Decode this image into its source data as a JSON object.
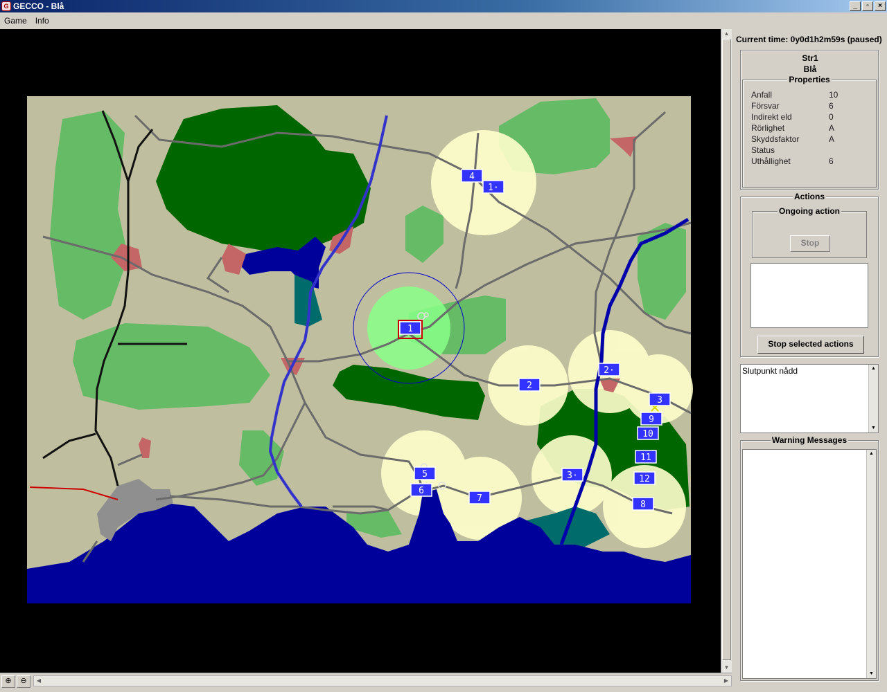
{
  "window": {
    "title": "GECCO - Blå",
    "app_icon": "gecco-logo-icon"
  },
  "menu": {
    "items": [
      "Game",
      "Info"
    ]
  },
  "status": {
    "current_time": "Current time: 0y0d1h2m59s (paused)"
  },
  "unit": {
    "name": "Str1",
    "side": "Blå"
  },
  "properties": {
    "title": "Properties",
    "rows": [
      {
        "key": "Anfall",
        "value": "10"
      },
      {
        "key": "Försvar",
        "value": "6"
      },
      {
        "key": "Indirekt eld",
        "value": "0"
      },
      {
        "key": "Rörlighet",
        "value": "A"
      },
      {
        "key": "Skyddsfaktor",
        "value": "A"
      },
      {
        "key": "Status",
        "value": ""
      },
      {
        "key": "Uthållighet",
        "value": "6"
      }
    ]
  },
  "actions": {
    "title": "Actions",
    "ongoing_title": "Ongoing action",
    "stop_label": "Stop",
    "stop_selected_label": "Stop selected actions"
  },
  "messages": {
    "text": "Slutpunkt nådd"
  },
  "warnings": {
    "title": "Warning Messages"
  },
  "map": {
    "colors": {
      "background": "#000000",
      "terrain": "#bfbf9f",
      "light_forest": "#66bb66",
      "dense_forest": "#006600",
      "water": "#00009b",
      "lake_teal": "#006b6b",
      "town": "#c46666",
      "road": "#6b6b6b",
      "river": "#3333cc",
      "unit_fill": "#3333ff",
      "selection": "#cc0000"
    },
    "units": [
      {
        "label": "4"
      },
      {
        "label": "1·"
      },
      {
        "label": "1"
      },
      {
        "label": "2"
      },
      {
        "label": "2·"
      },
      {
        "label": "3"
      },
      {
        "label": "9"
      },
      {
        "label": "10"
      },
      {
        "label": "11"
      },
      {
        "label": "12"
      },
      {
        "label": "8"
      },
      {
        "label": "3·"
      },
      {
        "label": "5"
      },
      {
        "label": "6"
      },
      {
        "label": "7"
      }
    ]
  }
}
